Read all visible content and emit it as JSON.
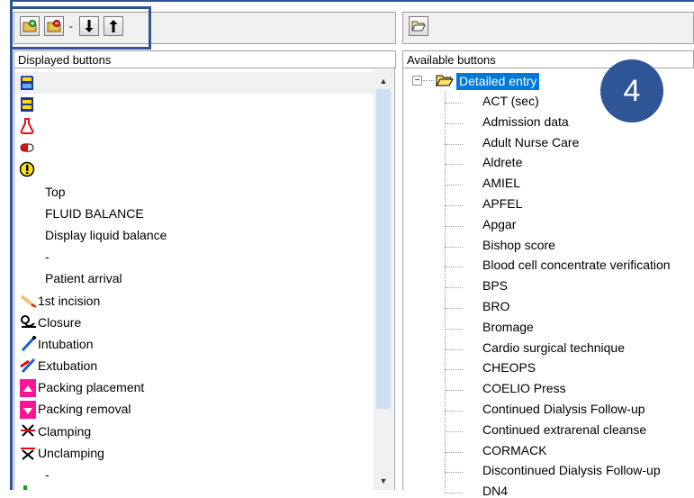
{
  "left_toolbar": {
    "separator": "-"
  },
  "left_panel": {
    "header": "Displayed buttons",
    "items": [
      {
        "label": "",
        "icon": "film-strip-icon"
      },
      {
        "label": "",
        "icon": "film-yellow-icon"
      },
      {
        "label": "",
        "icon": "flask-red-icon"
      },
      {
        "label": "",
        "icon": "capsule-red-icon"
      },
      {
        "label": "",
        "icon": "warning-exclamation-icon"
      },
      {
        "label": "Top",
        "icon": ""
      },
      {
        "label": "FLUID BALANCE",
        "icon": ""
      },
      {
        "label": "Display liquid balance",
        "icon": ""
      },
      {
        "label": "-",
        "icon": ""
      },
      {
        "label": "Patient arrival",
        "icon": ""
      },
      {
        "label": "1st incision",
        "icon": "scalpel-icon"
      },
      {
        "label": "Closure",
        "icon": "suture-icon"
      },
      {
        "label": "Intubation",
        "icon": "tube-blue-icon"
      },
      {
        "label": "Extubation",
        "icon": "tube-red-blue-icon"
      },
      {
        "label": "Packing placement",
        "icon": "packing-pink-icon"
      },
      {
        "label": "Packing removal",
        "icon": "packing-pink-icon"
      },
      {
        "label": "Clamping",
        "icon": "clamp-icon"
      },
      {
        "label": "Unclamping",
        "icon": "unclamp-icon"
      },
      {
        "label": "-",
        "icon": ""
      }
    ]
  },
  "right_panel": {
    "header": "Available buttons",
    "root": {
      "label": "Detailed entry",
      "expander": "⊟",
      "icon": "folder-open-icon"
    },
    "items": [
      "ACT (sec)",
      "Admission data",
      "Adult Nurse Care",
      "Aldrete",
      "AMIEL",
      "APFEL",
      "Apgar",
      "Bishop score",
      "Blood cell concentrate verification",
      "BPS",
      "BRO",
      "Bromage",
      "Cardio surgical technique",
      "CHEOPS",
      "COELIO Press",
      "Continued Dialysis Follow-up",
      "Continued extrarenal cleanse",
      "CORMACK",
      "Discontinued Dialysis Follow-up",
      "DN4"
    ]
  },
  "annotation": {
    "badge_number": "4"
  },
  "colors": {
    "accent": "#2f5597",
    "selection": "#0078d7",
    "scroll_thumb": "#cde0f3"
  }
}
